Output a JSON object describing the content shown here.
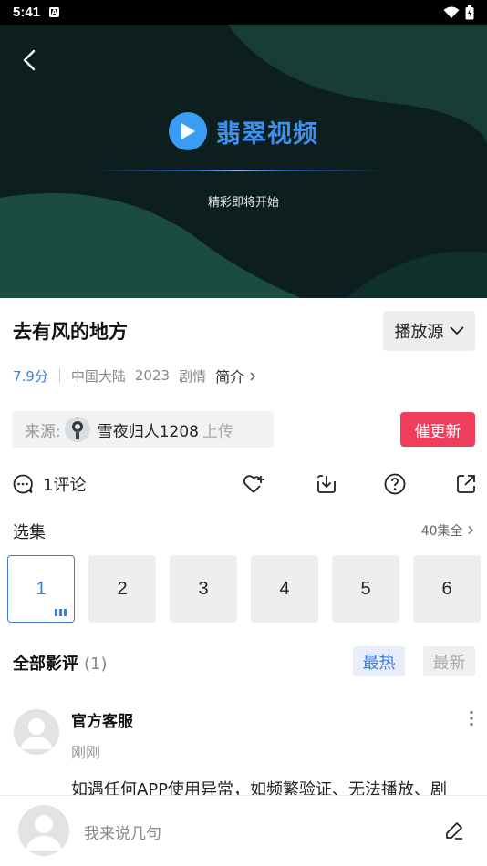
{
  "status_bar": {
    "time": "5:41",
    "notification_icon": "A"
  },
  "player": {
    "logo_text": "翡翠视频",
    "hint": "精彩即将开始"
  },
  "video": {
    "title": "去有风的地方",
    "source_select_label": "播放源",
    "score": "7.9分",
    "region": "中国大陆",
    "year": "2023",
    "genre": "剧情",
    "intro_label": "简介"
  },
  "uploader": {
    "label": "来源:",
    "name": "雪夜归人1208",
    "suffix": "上传",
    "urge_button": "催更新"
  },
  "actions": {
    "comment_count": "1评论"
  },
  "episodes": {
    "title": "选集",
    "total": "40集全",
    "items": [
      "1",
      "2",
      "3",
      "4",
      "5",
      "6"
    ],
    "active_index": 0
  },
  "reviews": {
    "title": "全部影评",
    "count": "(1)",
    "sort_hot": "最热",
    "sort_new": "最新",
    "items": [
      {
        "author": "官方客服",
        "time": "刚刚",
        "text": "如遇任何APP使用异常，如频繁验证、无法播放、剧"
      }
    ]
  },
  "bottom_bar": {
    "placeholder": "我来说几句"
  },
  "colors": {
    "accent_blue": "#3a7be0",
    "urge_red": "#f03d5b",
    "logo_blue": "#3b9cf5"
  }
}
